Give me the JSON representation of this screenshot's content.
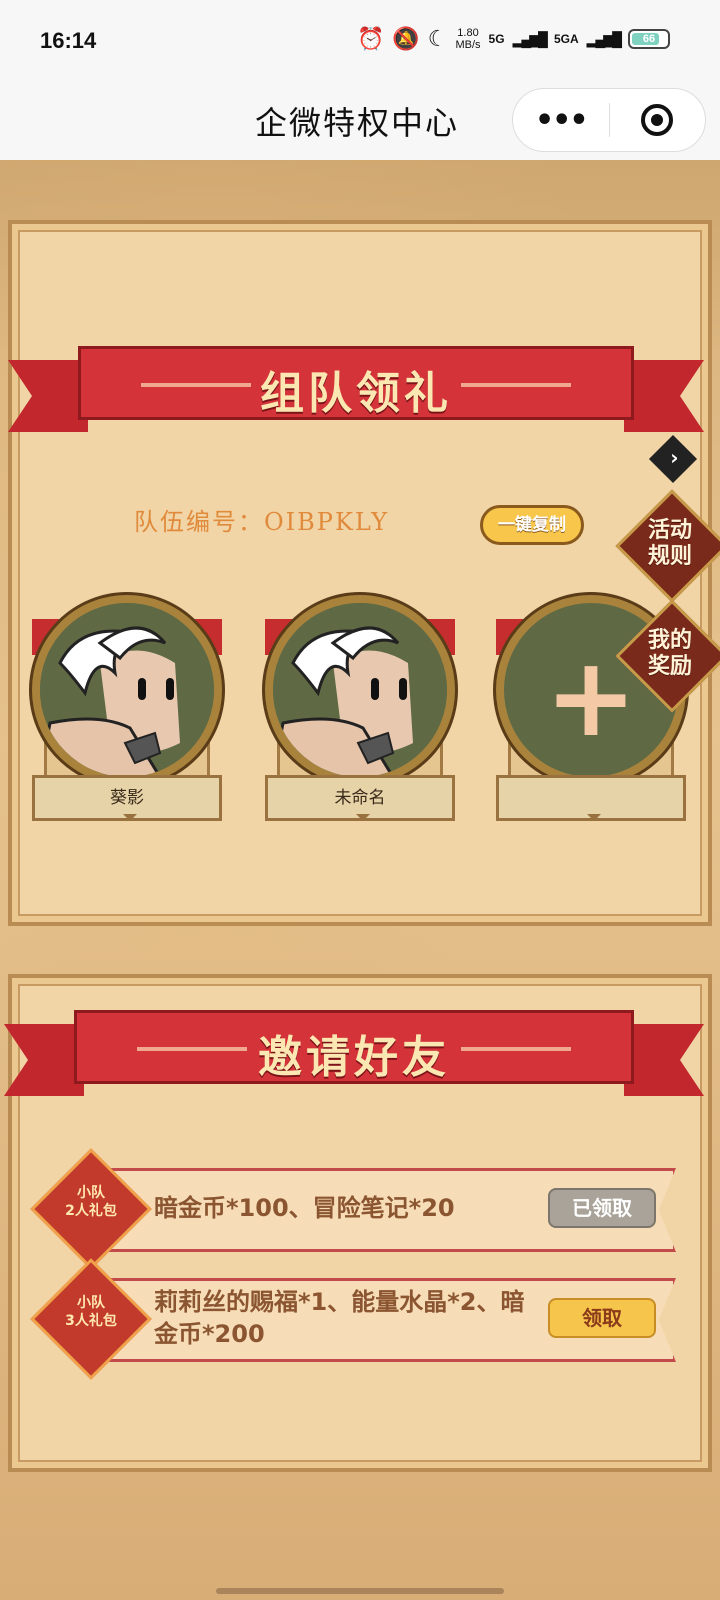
{
  "status_bar": {
    "time": "16:14",
    "net_speed_value": "1.80",
    "net_speed_unit": "MB/s",
    "network_1": "5G",
    "network_2": "5GA",
    "battery": "66"
  },
  "title_bar": {
    "title": "企微特权中心",
    "more_label": "•••"
  },
  "team_section": {
    "heading": "组队领礼",
    "team_id_text": "队伍编号：OIBPKLY",
    "copy_button": "一键复制",
    "rules_button": "活动\n规则",
    "rewards_button": "我的\n奖励",
    "members": [
      {
        "name": "葵影"
      },
      {
        "name": "未命名"
      },
      {
        "name": ""
      }
    ],
    "add_icon": "+"
  },
  "invite_section": {
    "heading": "邀请好友",
    "rewards": [
      {
        "badge": "小队\n2人礼包",
        "description": "暗金币*100、冒险笔记*20",
        "action": "已领取",
        "status": "claimed"
      },
      {
        "badge": "小队\n3人礼包",
        "description": "莉莉丝的赐福*1、能量水晶*2、暗金币*200",
        "action": "领取",
        "status": "available"
      }
    ]
  },
  "colors": {
    "ribbon_red": "#d4333a",
    "panel_bg": "#f2d5a6",
    "team_id_orange": "#e08a3c",
    "claim_button": "#f6c54b",
    "claimed_button": "#a9a39a"
  },
  "icons": [
    "alarm-icon",
    "mute-bell-icon",
    "moon-icon",
    "signal-icon",
    "battery-icon",
    "more-icon",
    "close-target-icon",
    "chevron-right-icon",
    "plus-icon"
  ]
}
